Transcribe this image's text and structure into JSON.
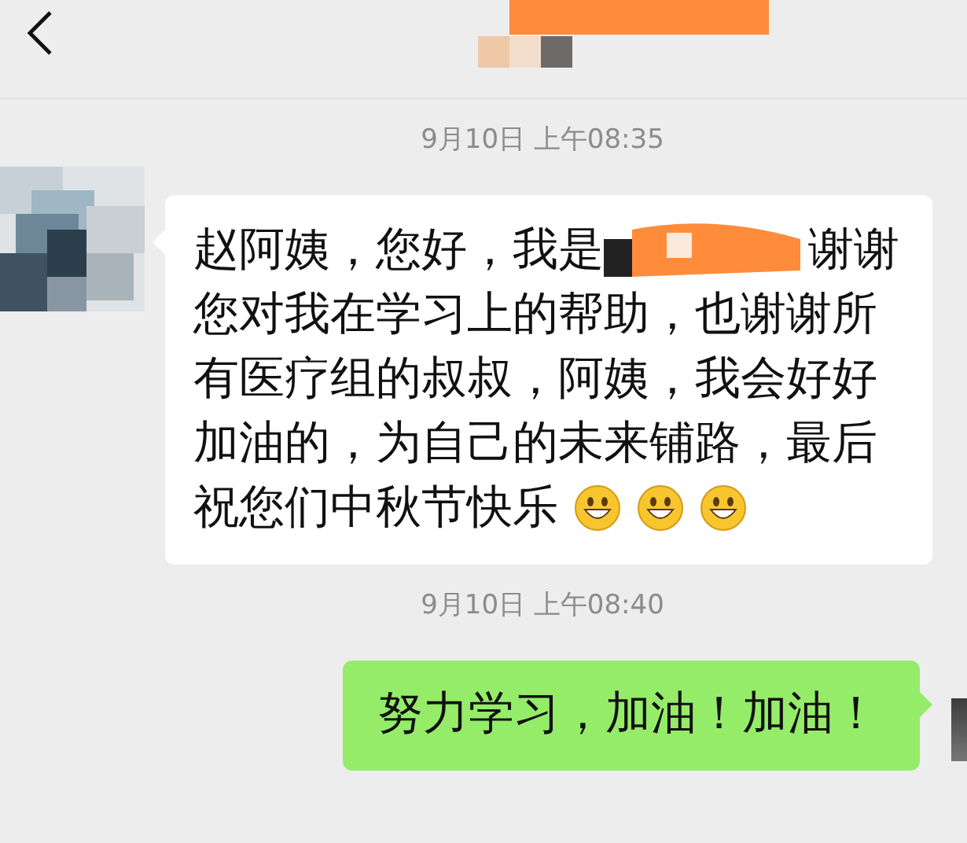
{
  "messages": [
    {
      "kind": "time",
      "text": "9月10日 上午08:35"
    },
    {
      "kind": "incoming",
      "before": "赵阿姨，您好，我是",
      "after": "谢谢",
      "middle": "您对我在学习上的帮助，也谢谢所有医疗组的叔叔，阿姨，我会好好加油的，为自己的未来铺路，最后",
      "last": "祝您们中秋节快乐"
    },
    {
      "kind": "time",
      "text": "9月10日 上午08:40"
    },
    {
      "kind": "outgoing",
      "text": "努力学习，加油！加油！"
    }
  ]
}
